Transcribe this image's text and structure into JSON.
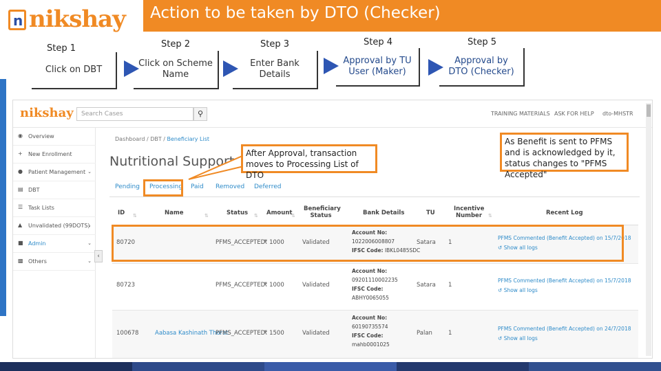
{
  "header": {
    "logo_text": "nikshay",
    "logo_letter": "n",
    "title": "Action to be taken by DTO (Checker)"
  },
  "steps": [
    {
      "label": "Step 1",
      "text": "Click on DBT"
    },
    {
      "label": "Step 2",
      "text": "Click on Scheme Name"
    },
    {
      "label": "Step 3",
      "text": "Enter Bank Details"
    },
    {
      "label": "Step 4",
      "text": "Approval by TU User (Maker)"
    },
    {
      "label": "Step 5",
      "text": "Approval by DTO (Checker)"
    }
  ],
  "app": {
    "logo_text": "nikshay",
    "search_placeholder": "Search Cases",
    "search_icon": "search-icon",
    "nav": {
      "training": "TRAINING MATERIALS",
      "help": "ASK FOR HELP",
      "user": "dto-MHSTR"
    },
    "sidebar": [
      {
        "label": "Overview",
        "icon": "dashboard-icon",
        "chevron": false
      },
      {
        "label": "New Enrollment",
        "icon": "plus-icon",
        "chevron": false
      },
      {
        "label": "Patient Management",
        "icon": "user-icon",
        "chevron": true
      },
      {
        "label": "DBT",
        "icon": "bank-icon",
        "chevron": false
      },
      {
        "label": "Task Lists",
        "icon": "list-icon",
        "chevron": false
      },
      {
        "label": "Unvalidated (99DOTS)",
        "icon": "warning-icon",
        "chevron": true
      },
      {
        "label": "Admin",
        "icon": "lock-icon",
        "chevron": true
      },
      {
        "label": "Others",
        "icon": "folder-icon",
        "chevron": true
      }
    ],
    "breadcrumb": [
      "Dashboard",
      "DBT",
      "Beneficiary List"
    ],
    "page_title": "Nutritional Support Sc",
    "tabs": [
      "Pending",
      "Processing",
      "Paid",
      "Removed",
      "Deferred"
    ],
    "columns": [
      "ID",
      "Name",
      "Status",
      "Amount",
      "Beneficiary Status",
      "Bank Details",
      "TU",
      "Incentive Number",
      "Recent Log"
    ],
    "rows": [
      {
        "id": "80720",
        "name": "",
        "status": "PFMS_ACCEPTED",
        "amount": "₹ 1000",
        "ben_status": "Validated",
        "account_label": "Account No:",
        "account": "1022006008807",
        "ifsc_label": "IFSC Code:",
        "ifsc": "IBKL0485SDC",
        "tu": "Satara",
        "incentive": "1",
        "log": "PFMS Commented (Benefit Accepted) on 15/7/2018",
        "show": "Show all logs"
      },
      {
        "id": "80723",
        "name": "",
        "status": "PFMS_ACCEPTED",
        "amount": "₹ 1000",
        "ben_status": "Validated",
        "account_label": "Account No:",
        "account": "09201110002235",
        "ifsc_label": "IFSC Code:",
        "ifsc": "ABHY0065055",
        "tu": "Satara",
        "incentive": "1",
        "log": "PFMS Commented (Benefit Accepted) on 15/7/2018",
        "show": "Show all logs"
      },
      {
        "id": "100678",
        "name": "Aabasa Kashinath Thorat",
        "status": "PFMS_ACCEPTED",
        "amount": "₹ 1500",
        "ben_status": "Validated",
        "account_label": "Account No:",
        "account": "60190735574",
        "ifsc_label": "IFSC Code:",
        "ifsc": "mahb0001025",
        "tu": "Palan",
        "incentive": "1",
        "log": "PFMS Commented (Benefit Accepted) on 24/7/2018",
        "show": "Show all logs"
      }
    ]
  },
  "callouts": {
    "processing": "After Approval, transaction moves to Processing List of DTO",
    "pfms": "As Benefit is sent to PFMS and is acknowledged by it, status changes to \"PFMS Accepted\""
  },
  "colors": {
    "accent": "#f08a24",
    "arrow": "#2e56b3",
    "link": "#2e8bc9"
  }
}
